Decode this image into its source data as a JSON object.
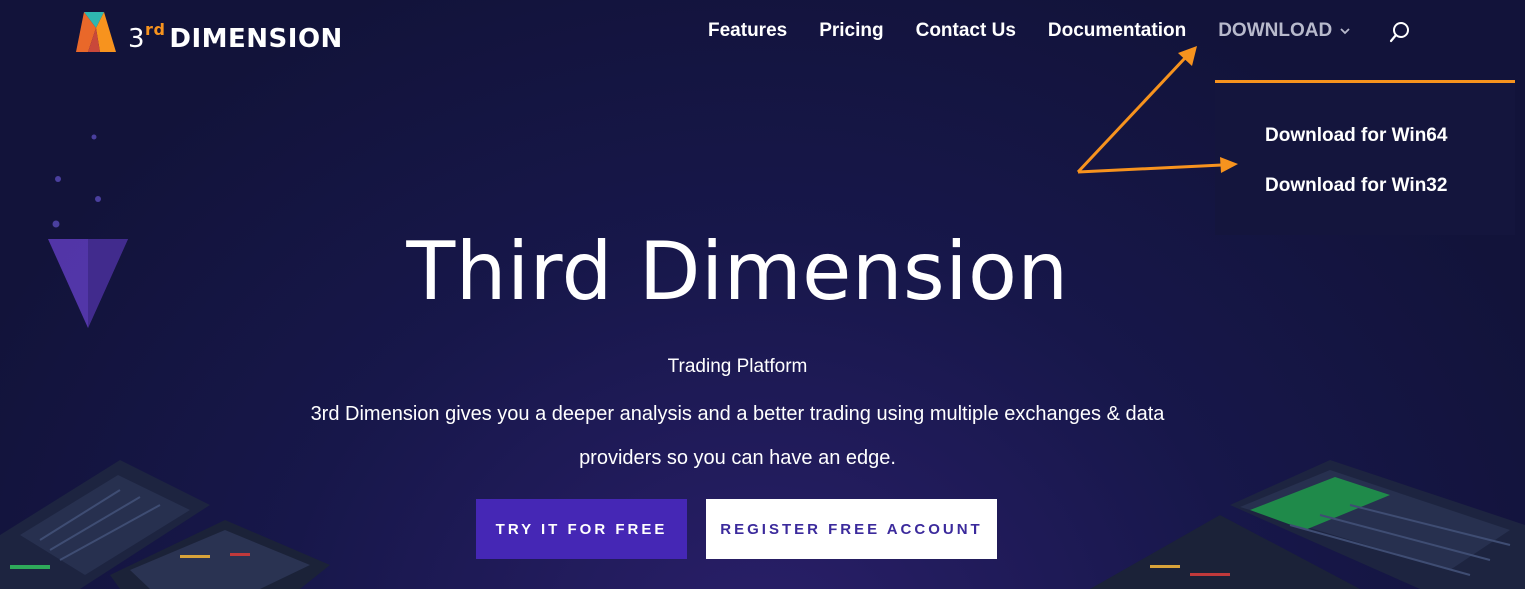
{
  "logo": {
    "digit": "3",
    "superscript": "rd",
    "wordmark": "DIMENSION"
  },
  "nav": {
    "items": [
      "Features",
      "Pricing",
      "Contact Us",
      "Documentation"
    ],
    "download_label": "DOWNLOAD"
  },
  "dropdown": {
    "items": [
      "Download for Win64",
      "Download for Win32"
    ]
  },
  "hero": {
    "title": "Third Dimension",
    "subtitle": "Trading Platform",
    "description": "3rd Dimension gives you a deeper analysis and a better trading using multiple exchanges & data providers so you can have an edge."
  },
  "buttons": {
    "try": "TRY IT FOR FREE",
    "register": "REGISTER FREE ACCOUNT"
  },
  "colors": {
    "background": "#12133a",
    "accent_orange": "#f7931e",
    "primary_purple": "#4527b5",
    "button_text_purple": "#3b2a9c"
  },
  "icons": {
    "search": "search-icon",
    "chevron": "chevron-down-icon"
  }
}
